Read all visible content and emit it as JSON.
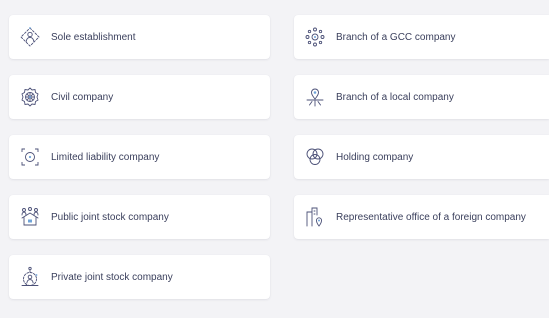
{
  "colors": {
    "background": "#f3f3f6",
    "card": "#ffffff",
    "text": "#3a3f5c",
    "icon_stroke": "#4b5077",
    "icon_accent": "#6fa3d8"
  },
  "company_types": [
    {
      "label": "Sole establishment",
      "icon": "person-outline-icon"
    },
    {
      "label": "Branch of a GCC company",
      "icon": "network-nodes-icon"
    },
    {
      "label": "Civil company",
      "icon": "gear-network-icon"
    },
    {
      "label": "Branch of a local company",
      "icon": "map-pin-rays-icon"
    },
    {
      "label": "Limited liability company",
      "icon": "bounded-circle-icon"
    },
    {
      "label": "Holding company",
      "icon": "overlapping-circles-icon"
    },
    {
      "label": "Public joint stock company",
      "icon": "people-house-icon"
    },
    {
      "label": "Representative office of a foreign company",
      "icon": "building-pin-icon"
    },
    {
      "label": "Private joint stock company",
      "icon": "person-circle-icon"
    }
  ]
}
